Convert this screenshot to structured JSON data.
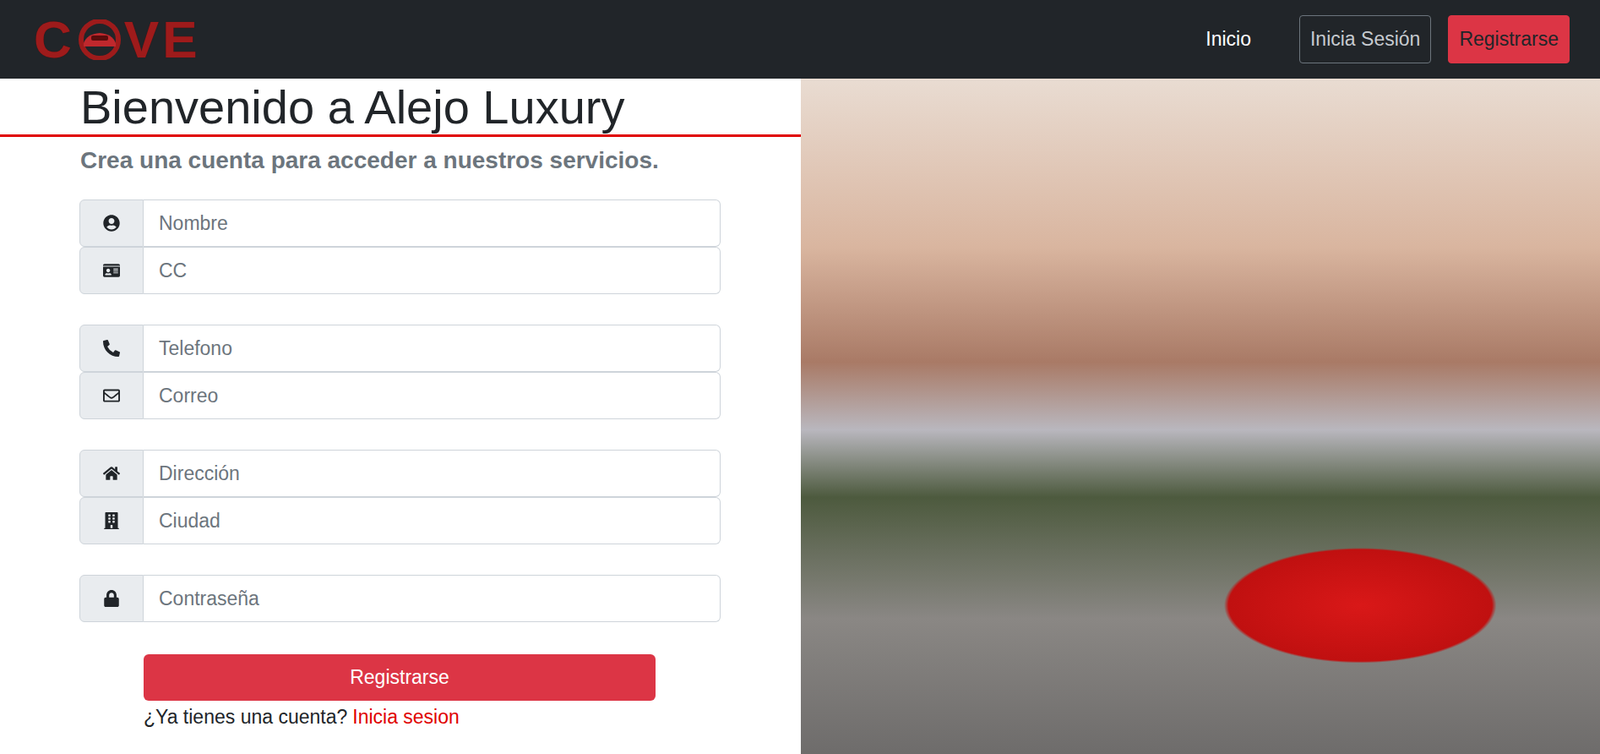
{
  "navbar": {
    "logo": {
      "start": "C",
      "end": "VE"
    },
    "links": [
      {
        "label": "Inicio",
        "kind": "link"
      },
      {
        "label": "Inicia Sesión",
        "kind": "outline"
      },
      {
        "label": "Registrarse",
        "kind": "primary"
      }
    ]
  },
  "form": {
    "heading": "Bienvenido a Alejo Luxury",
    "subtitle": "Crea una cuenta para acceder a nuestros servicios.",
    "groups": [
      [
        {
          "placeholder": "Nombre"
        },
        {
          "placeholder": "CC"
        }
      ],
      [
        {
          "placeholder": "Telefono"
        },
        {
          "placeholder": "Correo"
        }
      ],
      [
        {
          "placeholder": "Dirección"
        },
        {
          "placeholder": "Ciudad"
        }
      ],
      [
        {
          "placeholder": "Contraseña"
        }
      ]
    ],
    "submit": "Registrarse",
    "prompt": "¿Ya tienes una cuenta?",
    "login_link": "Inicia sesion"
  }
}
